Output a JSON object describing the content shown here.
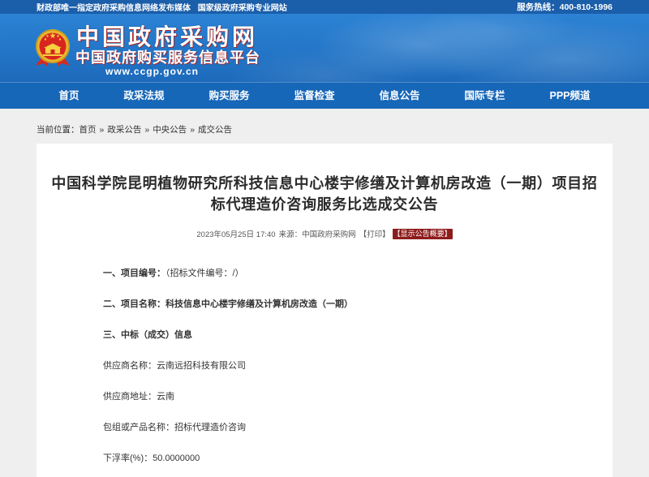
{
  "theme": {
    "top_bar": "#1b5ea9",
    "header": "#2274c6",
    "nav": "#1767b9",
    "badge": "#8e1c1c",
    "page_bg": "#efefef"
  },
  "top_bar": {
    "slogan_primary": "财政部唯一指定政府采购信息网络发布媒体",
    "slogan_secondary": "国家级政府采购专业网站",
    "hotline_label": "服务热线：",
    "hotline_number": "400-810-1996"
  },
  "header": {
    "emblem_icon": "national-emblem-icon",
    "site_name": "中国政府采购网",
    "subtitle": "中国政府购买服务信息平台",
    "url": "www.ccgp.gov.cn"
  },
  "nav": [
    "首页",
    "政采法规",
    "购买服务",
    "监督检查",
    "信息公告",
    "国际专栏",
    "PPP频道"
  ],
  "breadcrumb": {
    "label": "当前位置：",
    "separator": "»",
    "items": [
      "首页",
      "政采公告",
      "中央公告",
      "成交公告"
    ]
  },
  "article": {
    "title": "中国科学院昆明植物研究所科技信息中心楼宇修缮及计算机房改造（一期）项目招标代理造价咨询服务比选成交公告",
    "date": "2023年05月25日 17:40",
    "source_label": "来源：",
    "source": "中国政府采购网",
    "print": "【打印】",
    "summary_button": "【显示公告概要】"
  },
  "content": {
    "item1": {
      "label": "一、项目编号：",
      "value": "（招标文件编号：/）"
    },
    "item2": {
      "label": "二、项目名称：",
      "value": "科技信息中心楼宇修缮及计算机房改造（一期）"
    },
    "item3": {
      "label": "三、中标（成交）信息"
    },
    "supplier_name": {
      "label": "供应商名称：",
      "value": "云南远招科技有限公司"
    },
    "supplier_address": {
      "label": "供应商地址：",
      "value": "云南"
    },
    "package_name": {
      "label": "包组或产品名称：",
      "value": "招标代理造价咨询"
    },
    "discount_rate": {
      "label": "下浮率(%)：",
      "value": "50.0000000"
    }
  }
}
